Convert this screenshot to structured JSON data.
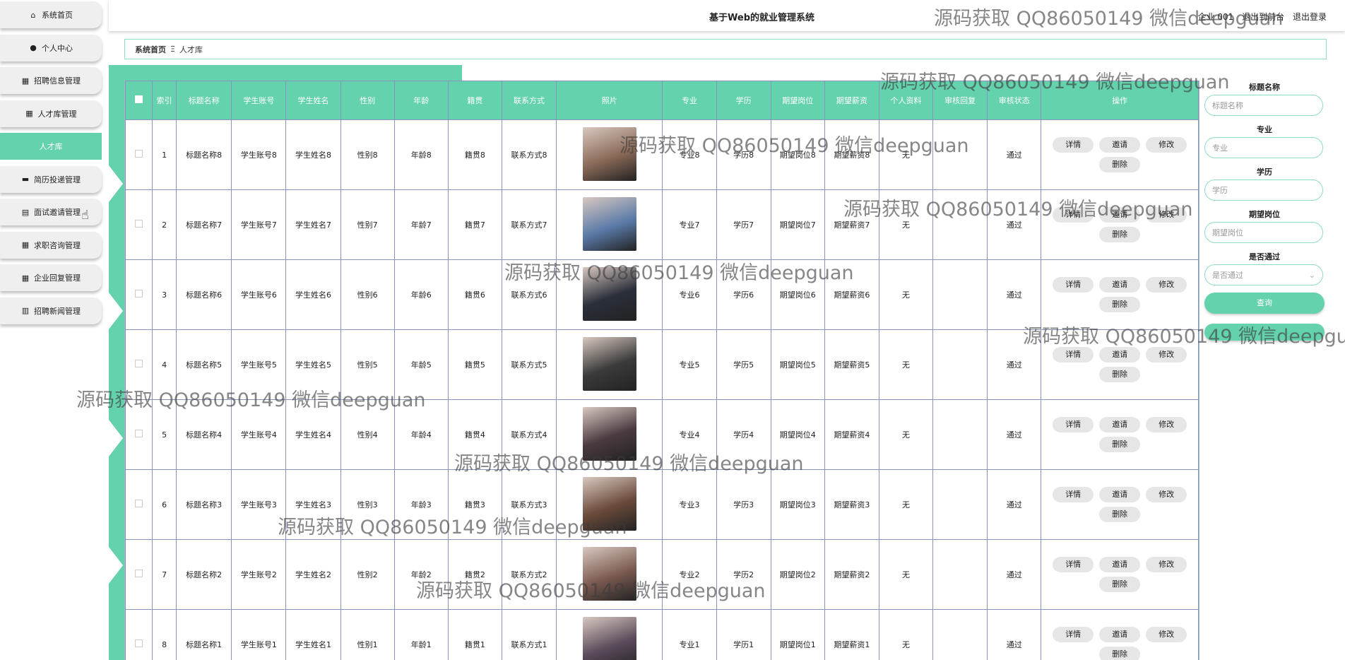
{
  "app": {
    "title": "基于Web的就业管理系统",
    "user_label": "企业 001",
    "exit_label": "退出到前台",
    "logout_label": "退出登录"
  },
  "sidebar": {
    "items": [
      {
        "icon": "home-icon",
        "glyph": "⌂",
        "label": "系统首页"
      },
      {
        "icon": "user-icon",
        "glyph": "●",
        "label": "个人中心"
      },
      {
        "icon": "grid-icon",
        "glyph": "▦",
        "label": "招聘信息管理"
      },
      {
        "icon": "grid-icon",
        "glyph": "▦",
        "label": "人才库管理"
      },
      {
        "icon": "",
        "glyph": "",
        "label": "人才库"
      },
      {
        "icon": "monitor-icon",
        "glyph": "▬",
        "label": "简历投递管理"
      },
      {
        "icon": "document-icon",
        "glyph": "▤",
        "label": "面试邀请管理"
      },
      {
        "icon": "grid-icon",
        "glyph": "▦",
        "label": "求职咨询管理"
      },
      {
        "icon": "grid-icon",
        "glyph": "▦",
        "label": "企业回复管理"
      },
      {
        "icon": "bars-icon",
        "glyph": "▥",
        "label": "招聘新闻管理"
      }
    ],
    "active_index": 4
  },
  "breadcrumb": {
    "home": "系统首页",
    "separator": "Ξ",
    "current": "人才库"
  },
  "table": {
    "columns": [
      "",
      "索引",
      "标题名称",
      "学生账号",
      "学生姓名",
      "性别",
      "年龄",
      "籍贯",
      "联系方式",
      "照片",
      "专业",
      "学历",
      "期望岗位",
      "期望薪资",
      "个人资料",
      "审核回复",
      "审核状态",
      "操作"
    ],
    "rows": [
      {
        "index": "1",
        "title": "标题名称8",
        "account": "学生账号8",
        "name": "学生姓名8",
        "gender": "性别8",
        "age": "年龄8",
        "origin": "籍贯8",
        "contact": "联系方式8",
        "major": "专业8",
        "education": "学历8",
        "position": "期望岗位8",
        "salary": "期望薪资8",
        "profile": "无",
        "reply": "",
        "status": "通过",
        "photo_color": "#8a6a58"
      },
      {
        "index": "2",
        "title": "标题名称7",
        "account": "学生账号7",
        "name": "学生姓名7",
        "gender": "性别7",
        "age": "年龄7",
        "origin": "籍贯7",
        "contact": "联系方式7",
        "major": "专业7",
        "education": "学历7",
        "position": "期望岗位7",
        "salary": "期望薪资7",
        "profile": "无",
        "reply": "",
        "status": "通过",
        "photo_color": "#5a7aa8"
      },
      {
        "index": "3",
        "title": "标题名称6",
        "account": "学生账号6",
        "name": "学生姓名6",
        "gender": "性别6",
        "age": "年龄6",
        "origin": "籍贯6",
        "contact": "联系方式6",
        "major": "专业6",
        "education": "学历6",
        "position": "期望岗位6",
        "salary": "期望薪资6",
        "profile": "无",
        "reply": "",
        "status": "通过",
        "photo_color": "#2a2f3a"
      },
      {
        "index": "4",
        "title": "标题名称5",
        "account": "学生账号5",
        "name": "学生姓名5",
        "gender": "性别5",
        "age": "年龄5",
        "origin": "籍贯5",
        "contact": "联系方式5",
        "major": "专业5",
        "education": "学历5",
        "position": "期望岗位5",
        "salary": "期望薪资5",
        "profile": "无",
        "reply": "",
        "status": "通过",
        "photo_color": "#3a3a3a"
      },
      {
        "index": "5",
        "title": "标题名称4",
        "account": "学生账号4",
        "name": "学生姓名4",
        "gender": "性别4",
        "age": "年龄4",
        "origin": "籍贯4",
        "contact": "联系方式4",
        "major": "专业4",
        "education": "学历4",
        "position": "期望岗位4",
        "salary": "期望薪资4",
        "profile": "无",
        "reply": "",
        "status": "通过",
        "photo_color": "#4a3a40"
      },
      {
        "index": "6",
        "title": "标题名称3",
        "account": "学生账号3",
        "name": "学生姓名3",
        "gender": "性别3",
        "age": "年龄3",
        "origin": "籍贯3",
        "contact": "联系方式3",
        "major": "专业3",
        "education": "学历3",
        "position": "期望岗位3",
        "salary": "期望薪资3",
        "profile": "无",
        "reply": "",
        "status": "通过",
        "photo_color": "#6a4a3a"
      },
      {
        "index": "7",
        "title": "标题名称2",
        "account": "学生账号2",
        "name": "学生姓名2",
        "gender": "性别2",
        "age": "年龄2",
        "origin": "籍贯2",
        "contact": "联系方式2",
        "major": "专业2",
        "education": "学历2",
        "position": "期望岗位2",
        "salary": "期望薪资2",
        "profile": "无",
        "reply": "",
        "status": "通过",
        "photo_color": "#7a5a50"
      },
      {
        "index": "8",
        "title": "标题名称1",
        "account": "学生账号1",
        "name": "学生姓名1",
        "gender": "性别1",
        "age": "年龄1",
        "origin": "籍贯1",
        "contact": "联系方式1",
        "major": "专业1",
        "education": "学历1",
        "position": "期望岗位1",
        "salary": "期望薪资1",
        "profile": "无",
        "reply": "",
        "status": "通过",
        "photo_color": "#5a4a5a"
      }
    ],
    "ops": {
      "detail": "详情",
      "invite": "邀请",
      "edit": "修改",
      "delete": "删除"
    }
  },
  "search": {
    "title_label": "标题名称",
    "title_placeholder": "标题名称",
    "major_label": "专业",
    "major_placeholder": "专业",
    "education_label": "学历",
    "education_placeholder": "学历",
    "position_label": "期望岗位",
    "position_placeholder": "期望岗位",
    "passed_label": "是否通过",
    "passed_placeholder": "是否通过",
    "query_button": "查询"
  },
  "watermark": {
    "text": "源码获取 QQ86050149 微信deepguan"
  },
  "colors": {
    "accent": "#64d2ad",
    "border": "#8a93b8"
  }
}
